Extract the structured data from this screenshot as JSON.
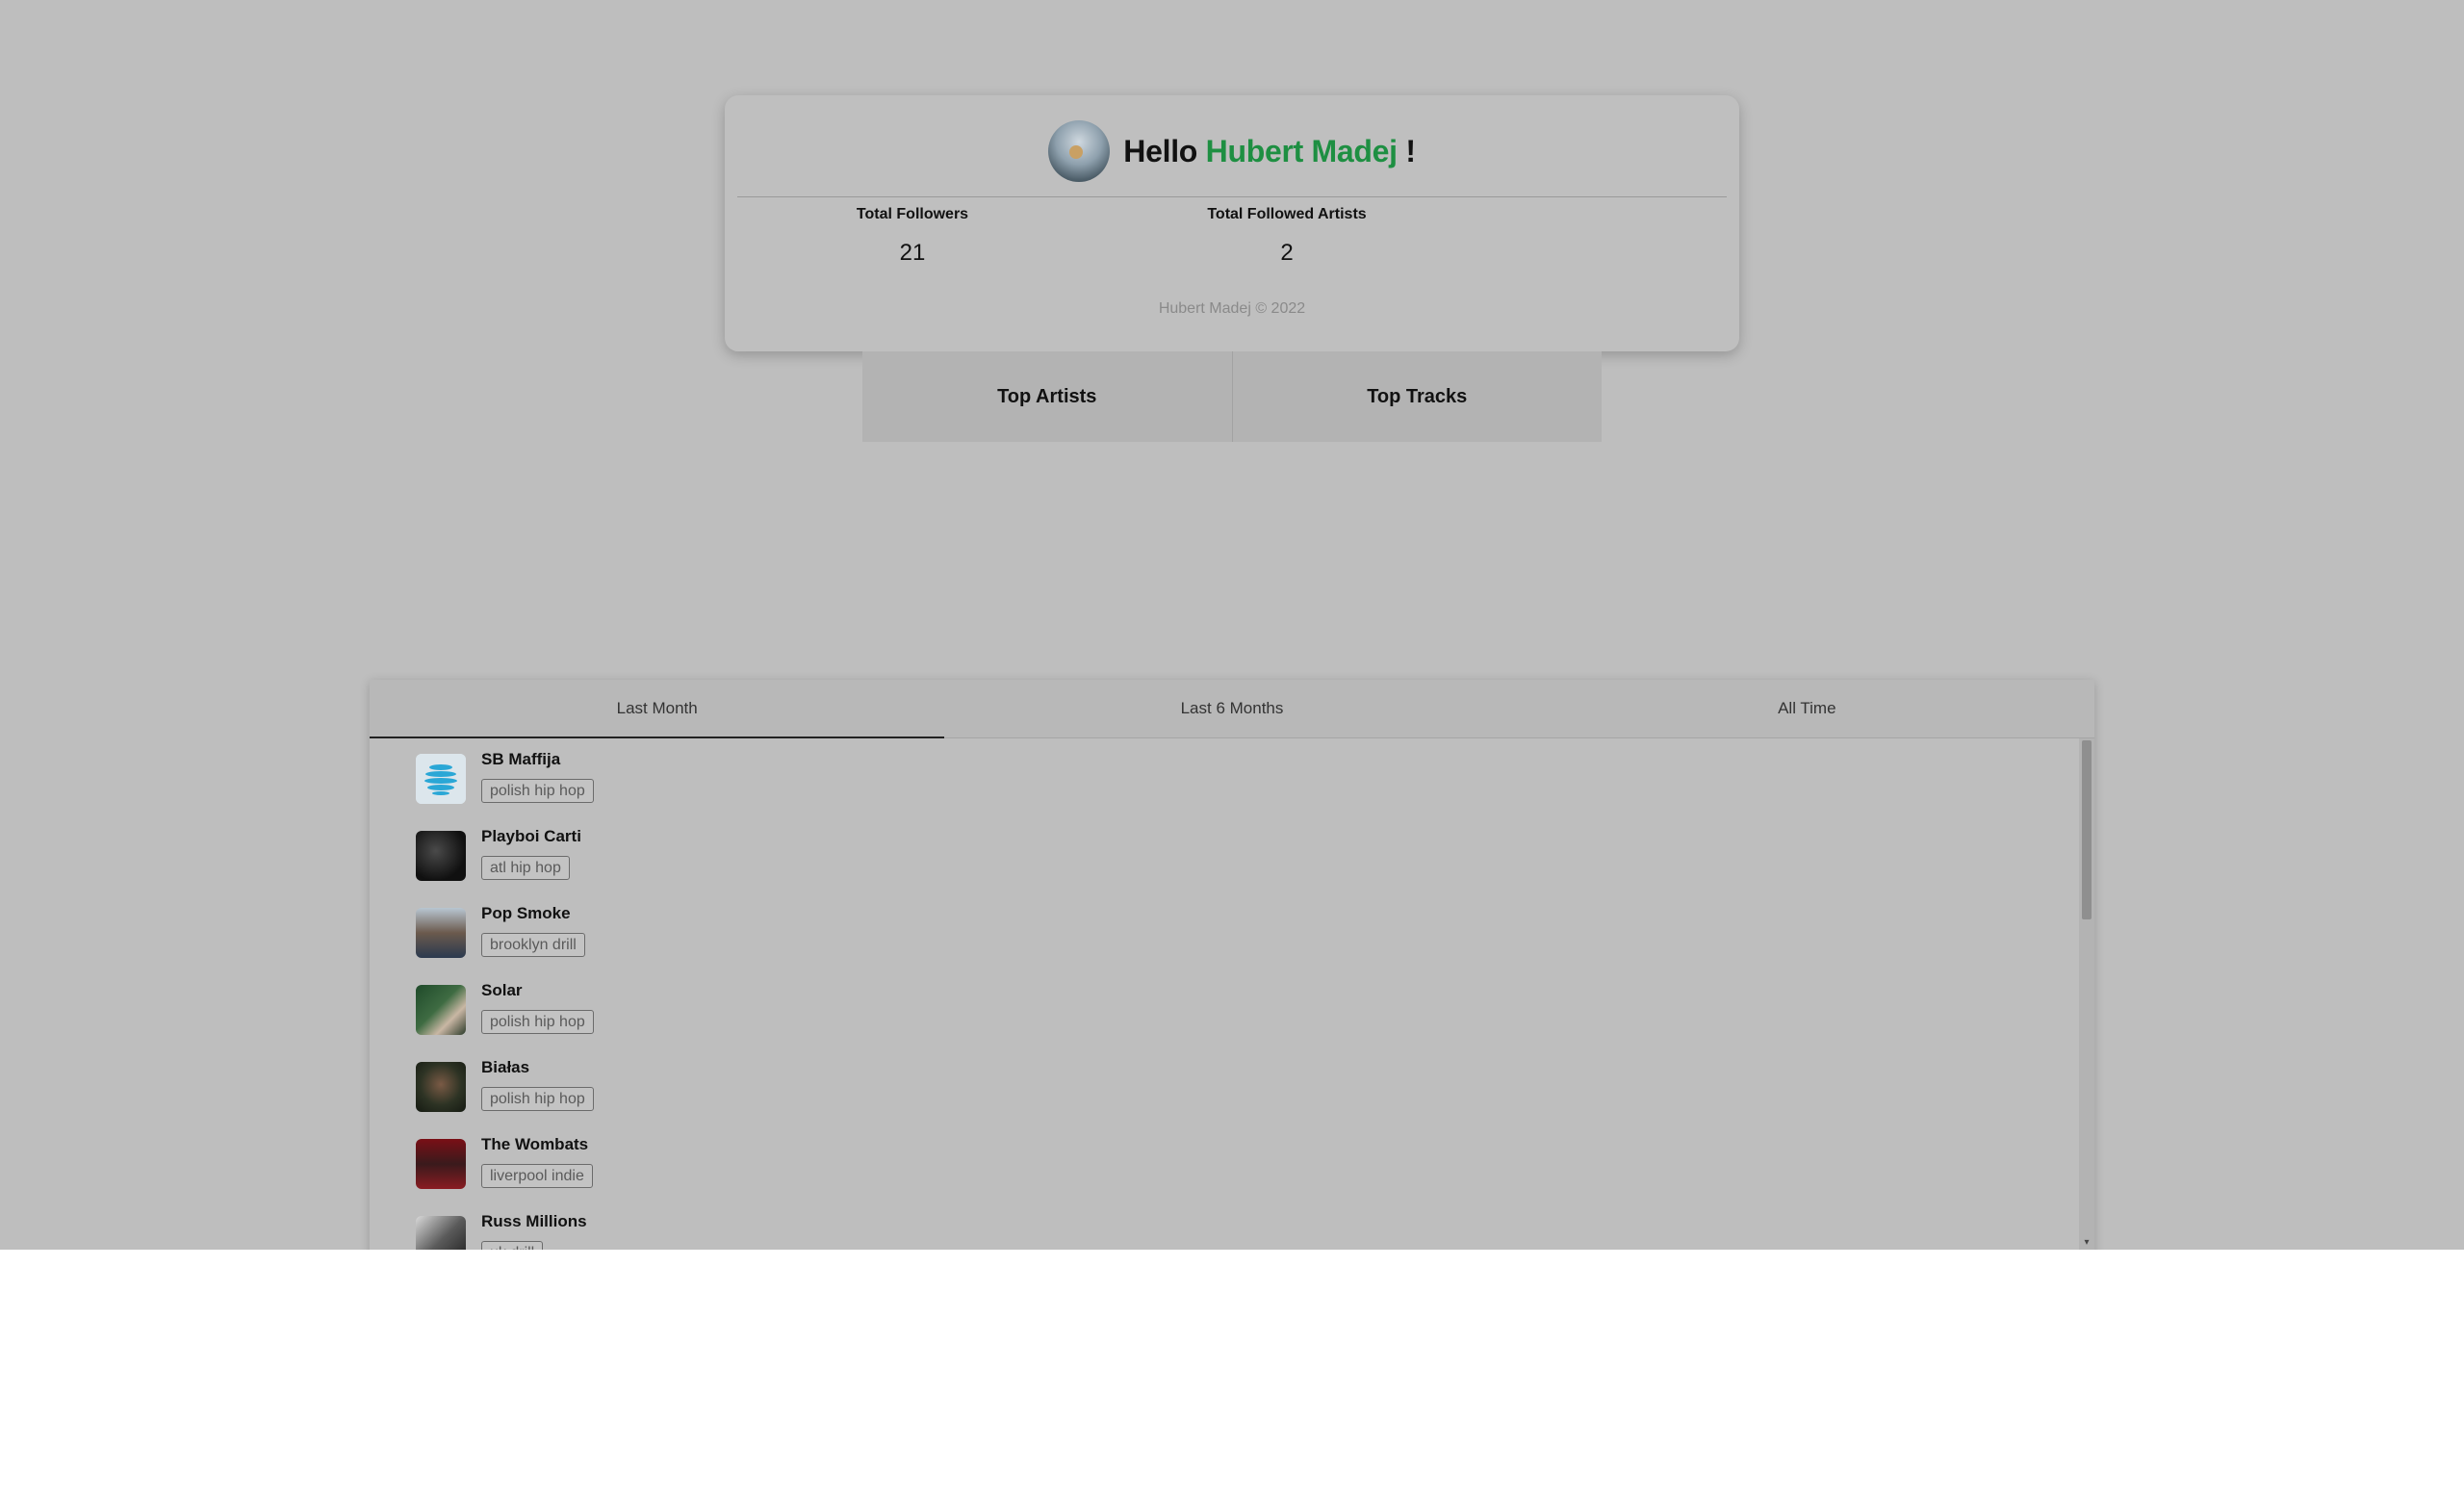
{
  "profile": {
    "greeting": "Hello",
    "user_name": "Hubert Madej",
    "exclamation": "!",
    "avatar_icon": "profile-avatar-image",
    "stats": {
      "followers_label": "Total Followers",
      "followers_value": "21",
      "followed_label": "Total Followed Artists",
      "followed_value": "2"
    },
    "copyright": "Hubert Madej © 2022"
  },
  "type_tabs": {
    "top_artists": "Top Artists",
    "top_tracks": "Top Tracks"
  },
  "period_tabs": {
    "last_month": "Last Month",
    "last_6_months": "Last 6 Months",
    "all_time": "All Time",
    "active": "Last Month"
  },
  "artists": [
    {
      "name": "SB Maffija",
      "genre": "polish hip hop"
    },
    {
      "name": "Playboi Carti",
      "genre": "atl hip hop"
    },
    {
      "name": "Pop Smoke",
      "genre": "brooklyn drill"
    },
    {
      "name": "Solar",
      "genre": "polish hip hop"
    },
    {
      "name": "Białas",
      "genre": "polish hip hop"
    },
    {
      "name": "The Wombats",
      "genre": "liverpool indie"
    },
    {
      "name": "Russ Millions",
      "genre": "uk drill"
    }
  ],
  "colors": {
    "accent_name": "#1e8f42",
    "background": "#bebebe"
  }
}
